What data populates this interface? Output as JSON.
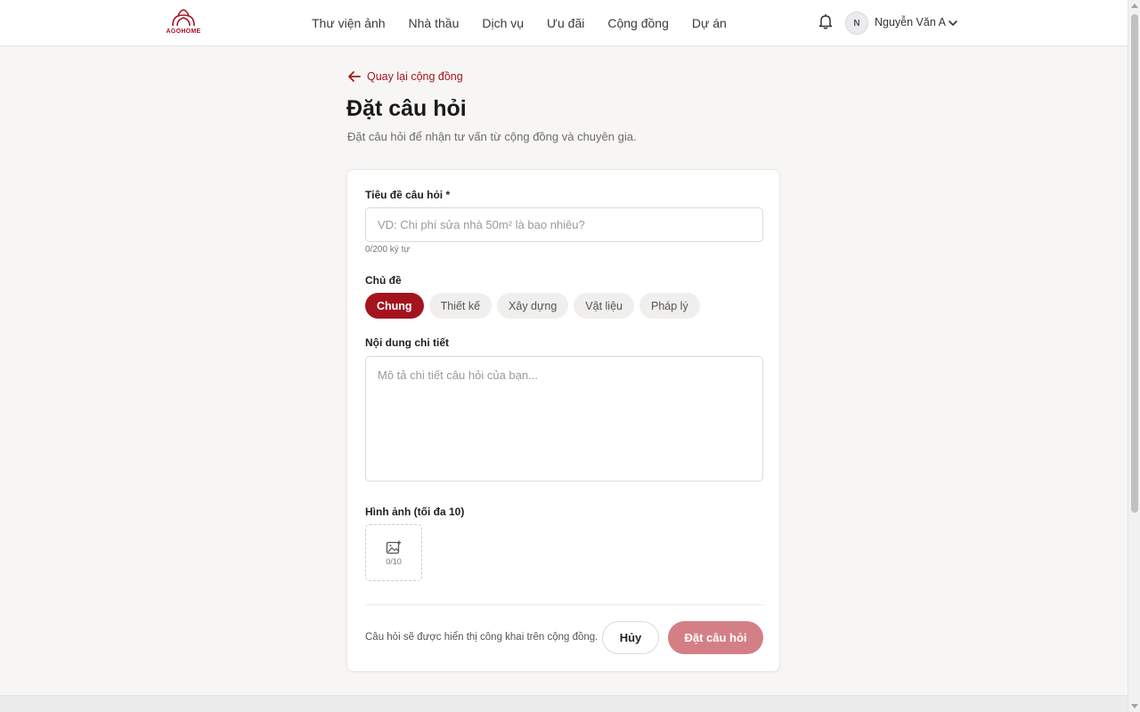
{
  "brand": {
    "logo_text": "AGOHOME",
    "accent_color": "#a4141f"
  },
  "nav": {
    "items": [
      {
        "label": "Thư viện ảnh"
      },
      {
        "label": "Nhà thầu"
      },
      {
        "label": "Dịch vụ"
      },
      {
        "label": "Ưu đãi"
      },
      {
        "label": "Cộng đồng"
      },
      {
        "label": "Dự án"
      }
    ]
  },
  "user": {
    "avatar_initial": "N",
    "name": "Nguyễn Văn A"
  },
  "page": {
    "back_label": "Quay lại cộng đồng",
    "title": "Đặt câu hỏi",
    "subtitle": "Đặt câu hỏi để nhận tư vấn từ cộng đồng và chuyên gia."
  },
  "form": {
    "title_label": "Tiêu đề câu hỏi *",
    "title_placeholder": "VD: Chi phí sửa nhà 50m² là bao nhiêu?",
    "title_value": "",
    "title_counter": "0/200 ký tự",
    "topic_label": "Chủ đề",
    "topics": [
      {
        "label": "Chung",
        "selected": true
      },
      {
        "label": "Thiết kế",
        "selected": false
      },
      {
        "label": "Xây dựng",
        "selected": false
      },
      {
        "label": "Vật liệu",
        "selected": false
      },
      {
        "label": "Pháp lý",
        "selected": false
      }
    ],
    "content_label": "Nội dung chi tiết",
    "content_placeholder": "Mô tả chi tiết câu hỏi của bạn...",
    "content_value": "",
    "images_label": "Hình ảnh (tối đa 10)",
    "images_count": "0/10",
    "notice": "Câu hỏi sẽ được hiển thị công khai trên cộng đồng.",
    "cancel_label": "Hủy",
    "submit_label": "Đặt câu hỏi"
  },
  "icons": {
    "bell": "bell-icon",
    "chevron": "chevron-down-icon",
    "back": "arrow-left-icon",
    "upload": "add-image-icon"
  },
  "colors": {
    "submit_disabled": "#d47f86",
    "chip_inactive": "#f0efed"
  }
}
